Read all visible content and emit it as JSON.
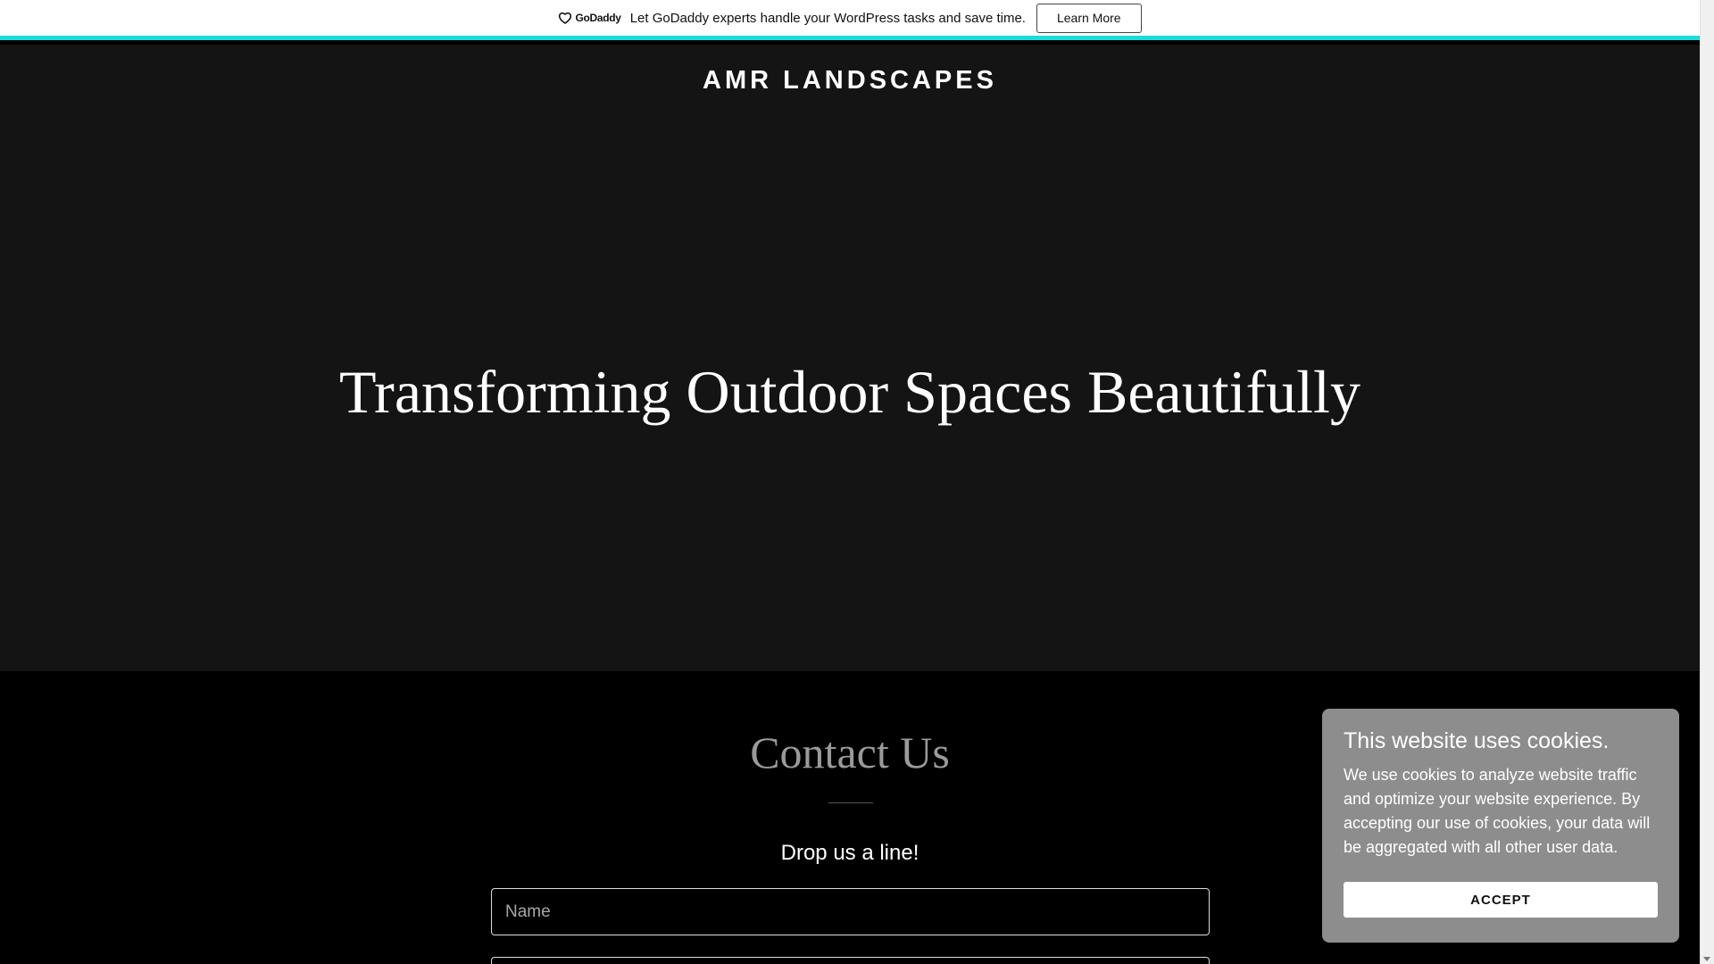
{
  "promo": {
    "logo_text": "GoDaddy",
    "message": "Let GoDaddy experts handle your WordPress tasks and save time.",
    "button_label": "Learn More",
    "accent_color": "#1bdbdb"
  },
  "header": {
    "site_title": "AMR LANDSCAPES"
  },
  "hero": {
    "heading": "Transforming Outdoor Spaces Beautifully"
  },
  "contact": {
    "title": "Contact Us",
    "subtitle": "Drop us a line!",
    "name_placeholder": "Name"
  },
  "cookie": {
    "title": "This website uses cookies.",
    "text": "We use cookies to analyze website traffic and optimize your website experience. By accepting our use of cookies, your data will be aggregated with all other user data.",
    "accept_label": "ACCEPT"
  }
}
